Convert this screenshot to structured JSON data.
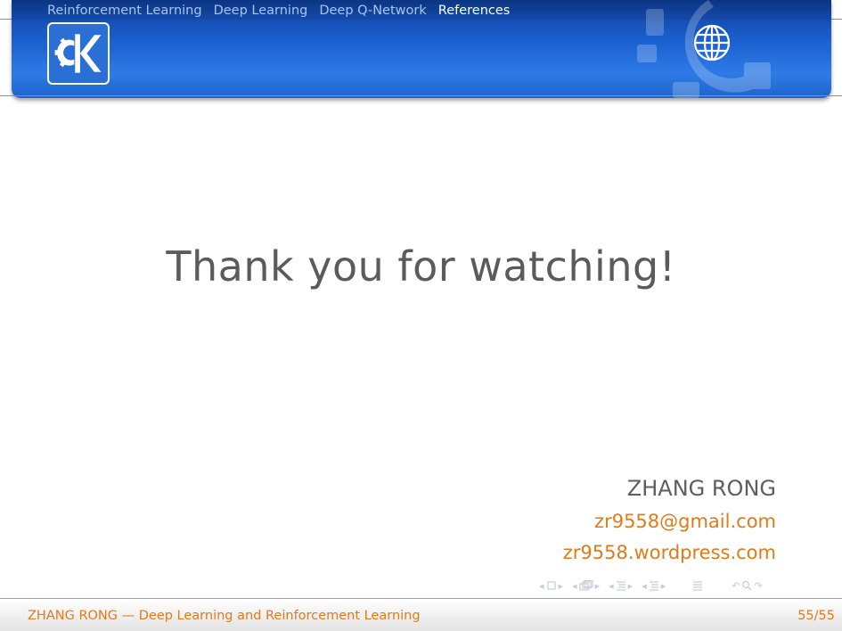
{
  "header": {
    "nav": [
      {
        "label": "Reinforcement Learning",
        "active": false
      },
      {
        "label": "Deep Learning",
        "active": false
      },
      {
        "label": "Deep Q-Network",
        "active": false
      },
      {
        "label": "References",
        "active": true
      }
    ]
  },
  "slide": {
    "title": "Thank you for watching!",
    "author_name": "ZHANG RONG",
    "email": "zr9558@gmail.com",
    "website": "zr9558.wordpress.com"
  },
  "footer": {
    "left_text": "ZHANG RONG — Deep Learning and Reinforcement Learning",
    "page_counter": "55/55"
  },
  "colors": {
    "header_blue": "#1a5fcf",
    "accent_orange": "#e07b1a",
    "title_gray": "#5b5b5b"
  }
}
